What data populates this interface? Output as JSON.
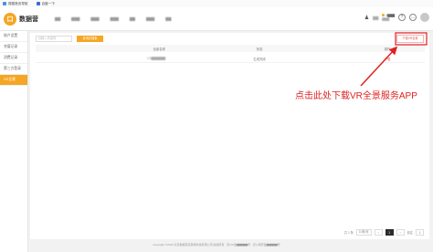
{
  "browser_bar": {
    "bookmarks": [
      {
        "label": "搜狐首页导航",
        "color": "#4a90e2"
      },
      {
        "label": "百度一下",
        "color": "#3f68d8"
      }
    ]
  },
  "header": {
    "logo_mark": "口",
    "logo_text": "数据营",
    "nav_items": [
      "▇▇",
      "▇▇▇",
      "▇▇▇",
      "▇▇▇",
      "▇▇",
      "▇▇▇",
      "▇▇"
    ],
    "username": "▇▇",
    "balance_lines": [
      "4▇▇▇",
      "▇▇▇"
    ],
    "icons": [
      "user-icon",
      "coin-icon",
      "help-icon",
      "chat-icon",
      "avatar"
    ]
  },
  "sidebar": {
    "items": [
      {
        "label": "账户设置",
        "active": false
      },
      {
        "label": "充值记录",
        "active": false
      },
      {
        "label": "消费记录",
        "active": false
      },
      {
        "label": "第三方登录",
        "active": false
      },
      {
        "label": "VR全景",
        "active": true
      }
    ]
  },
  "toolbar": {
    "search_placeholder": "请输入关键词",
    "search_button": "查询并搜索",
    "download_button": "下载VR全景"
  },
  "table": {
    "columns": [
      "全景名称",
      "状态",
      "操作"
    ],
    "rows": [
      {
        "name": "VR▇▇▇▇▇▇",
        "status": "生成完成",
        "action": "下载"
      }
    ]
  },
  "pagination": {
    "total_text": "共 1 条",
    "page_size": "10条/页",
    "prev": "‹",
    "current": "1",
    "next": "›",
    "goto_label": "前往",
    "goto_value": "1"
  },
  "footer": {
    "text": "Copyright ©2023 北京数据营互联网科技有限公司 版权所有 · 京ICP备▇▇▇▇号 · 京公网安备▇▇▇▇号"
  },
  "annotation": {
    "text": "点击此处下载VR全景服务APP",
    "color": "#e02020"
  }
}
